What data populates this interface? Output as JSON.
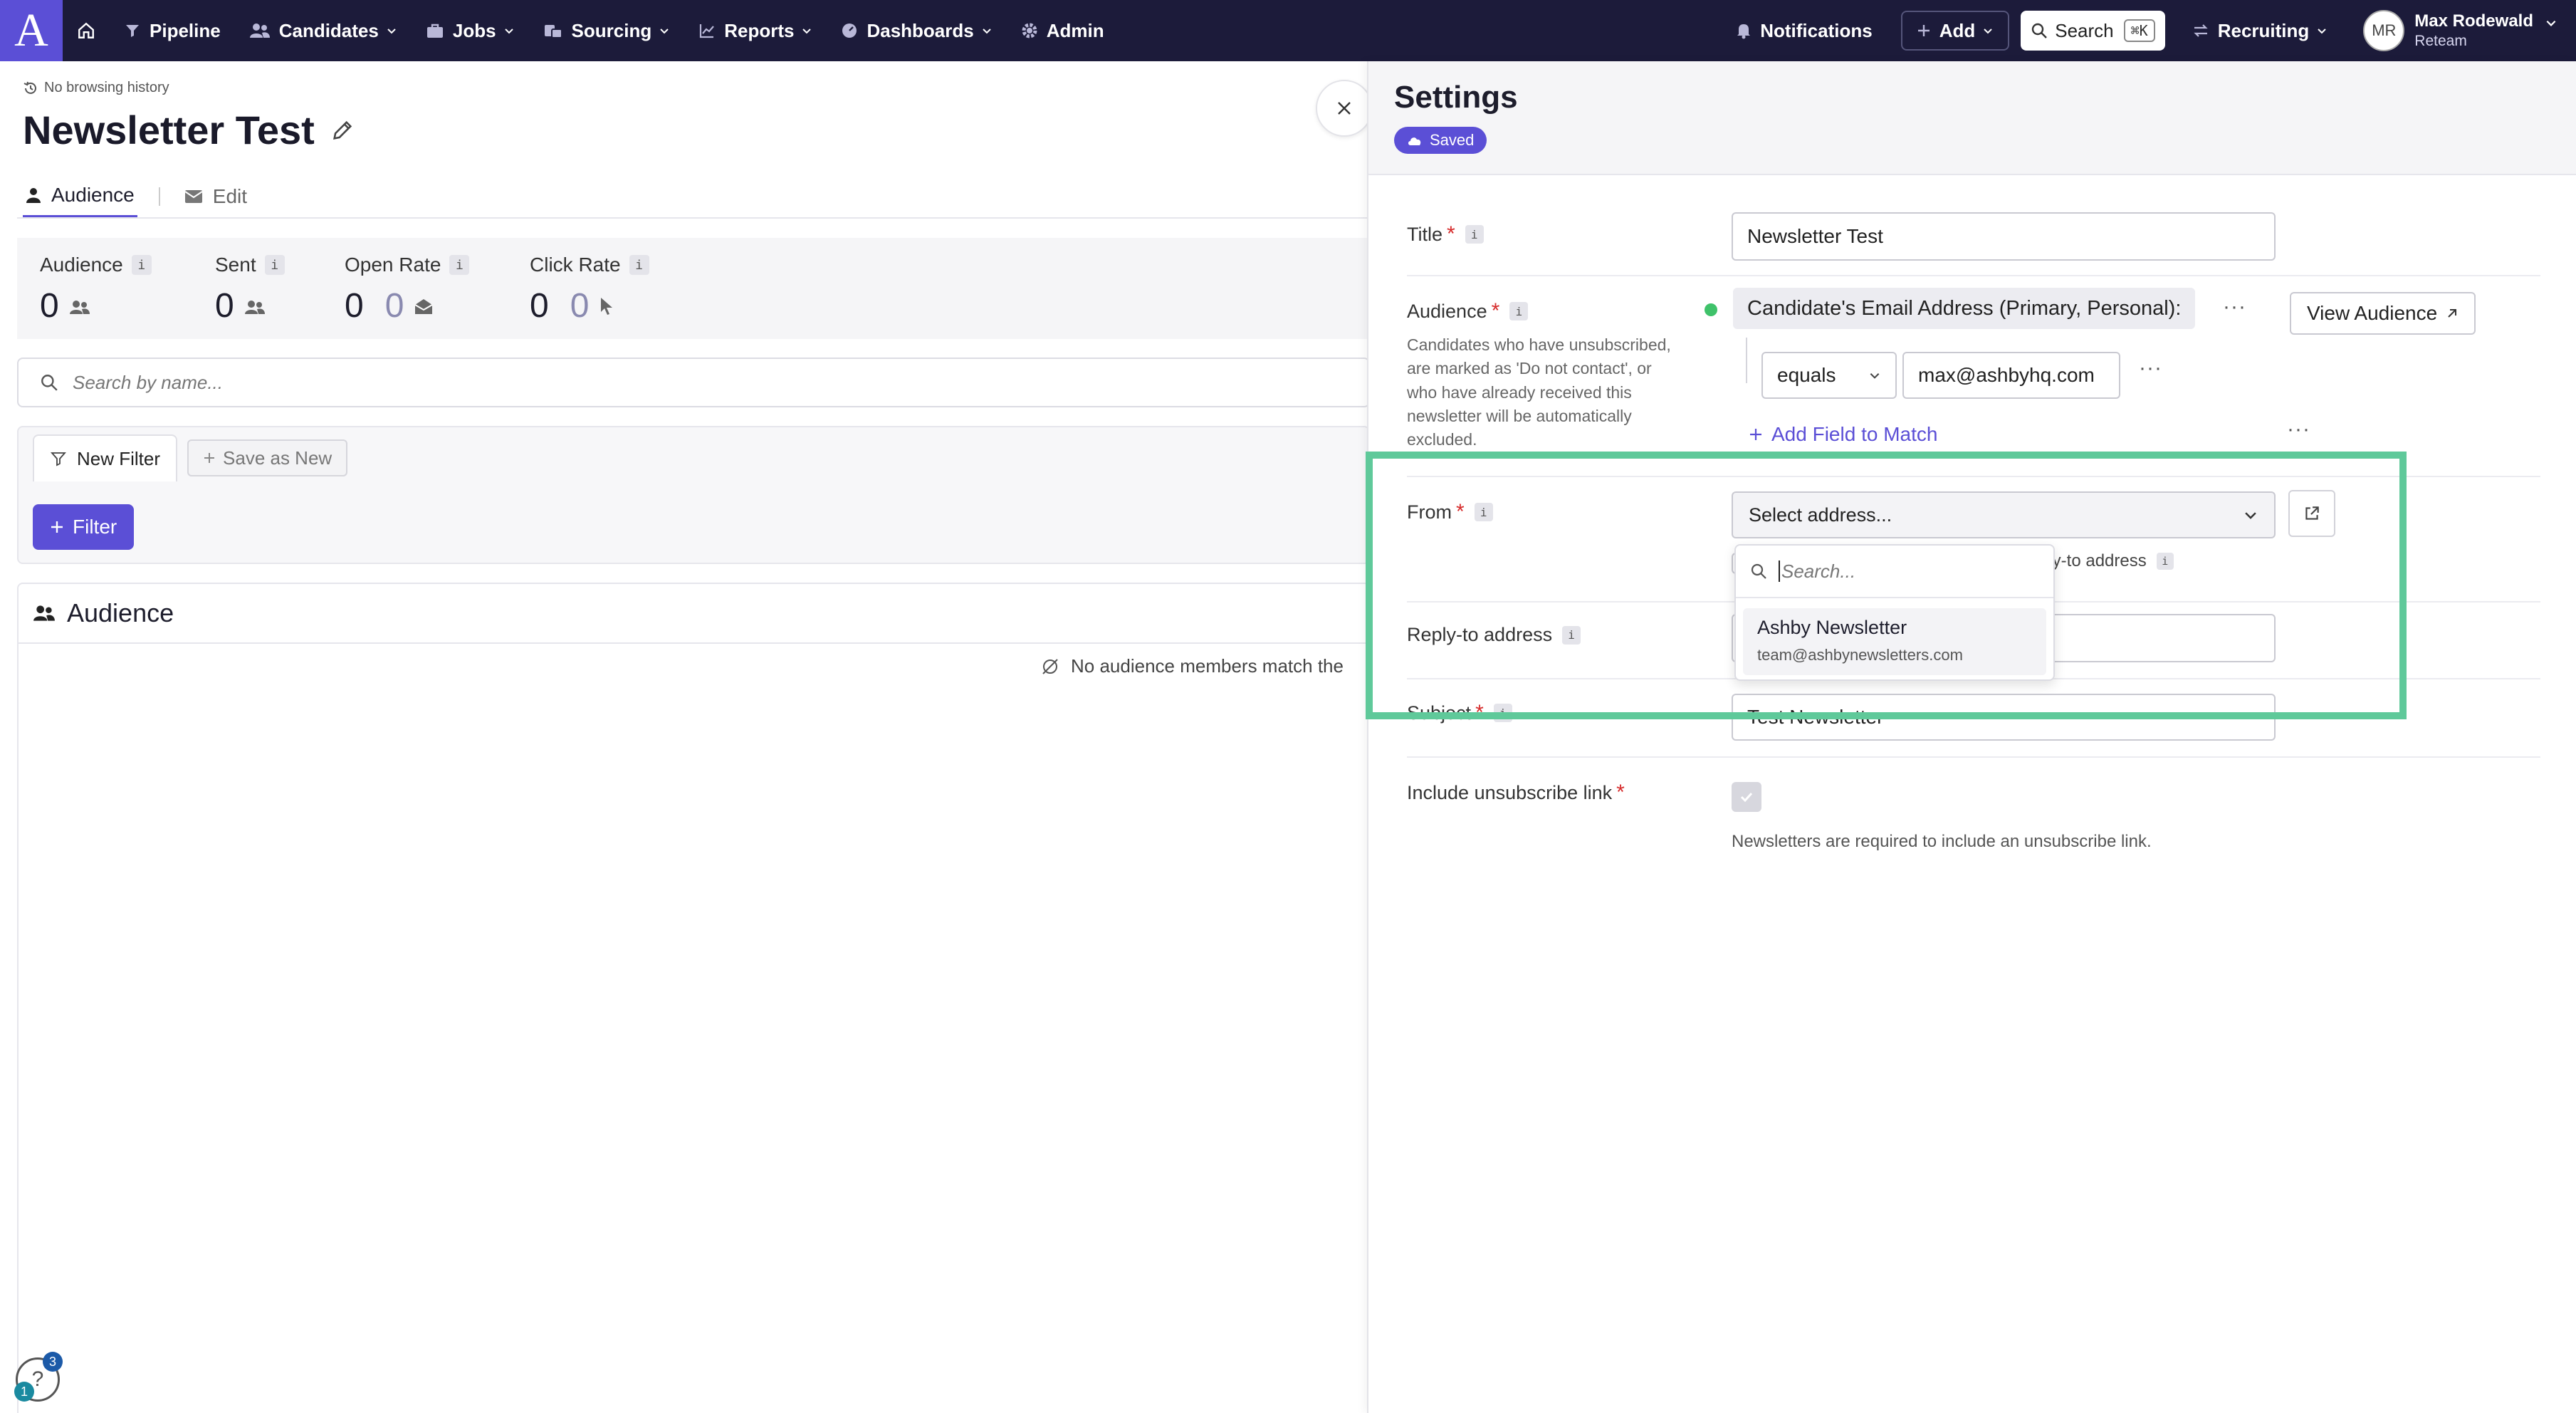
{
  "nav": {
    "logo": "A",
    "items": [
      {
        "label": "Pipeline",
        "icon": "filter-icon",
        "chevron": false
      },
      {
        "label": "Candidates",
        "icon": "people-icon",
        "chevron": true
      },
      {
        "label": "Jobs",
        "icon": "briefcase-icon",
        "chevron": true
      },
      {
        "label": "Sourcing",
        "icon": "sourcing-icon",
        "chevron": true
      },
      {
        "label": "Reports",
        "icon": "chart-icon",
        "chevron": true
      },
      {
        "label": "Dashboards",
        "icon": "gauge-icon",
        "chevron": true
      },
      {
        "label": "Admin",
        "icon": "gear-icon",
        "chevron": false
      }
    ],
    "notifications": "Notifications",
    "add": "Add",
    "search": "Search",
    "search_shortcut": "⌘K",
    "workspace": "Recruiting",
    "user_initials": "MR",
    "user_name": "Max Rodewald",
    "user_org": "Reteam"
  },
  "page": {
    "history": "No browsing history",
    "title": "Newsletter Test",
    "tabs": [
      {
        "label": "Audience"
      },
      {
        "label": "Edit"
      }
    ]
  },
  "stats": [
    {
      "label": "Audience",
      "value": "0",
      "value2": ""
    },
    {
      "label": "Sent",
      "value": "0",
      "value2": ""
    },
    {
      "label": "Open Rate",
      "value": "0",
      "value2": "0"
    },
    {
      "label": "Click Rate",
      "value": "0",
      "value2": "0"
    }
  ],
  "search": {
    "placeholder": "Search by name..."
  },
  "filters": {
    "new_filter": "New Filter",
    "save_as_new": "Save as New",
    "filter_button": "Filter"
  },
  "audience": {
    "heading": "Audience",
    "empty_text": "No audience members match the"
  },
  "help": {
    "badge_top": "3",
    "badge_bottom": "1"
  },
  "settings": {
    "title": "Settings",
    "status": "Saved",
    "fields": {
      "title_label": "Title",
      "title_value": "Newsletter Test",
      "audience_label": "Audience",
      "audience_help": "Candidates who have unsubscribed, are marked as 'Do not contact', or who have already received this newsletter will be automatically excluded.",
      "condition_field": "Candidate's Email Address (Primary, Personal):",
      "operator": "equals",
      "condition_value": "max@ashbyhq.com",
      "view_audience": "View Audience",
      "add_field": "Add Field to Match",
      "from_label": "From",
      "from_placeholder": "Select address...",
      "reply_hint": "ply-to address",
      "reply_label": "Reply-to address",
      "subject_label": "Subject",
      "subject_value": "Test Newsletter",
      "unsub_label": "Include unsubscribe link",
      "unsub_checked": true,
      "unsub_note": "Newsletters are required to include an unsubscribe link."
    },
    "dropdown": {
      "search_placeholder": "Search...",
      "options": [
        {
          "name": "Ashby Newsletter",
          "email": "team@ashbynewsletters.com"
        }
      ]
    }
  },
  "colors": {
    "nav_bg": "#1c1b3a",
    "accent": "#5b4fd6",
    "highlight": "#5fc99a",
    "required": "#d62b2b"
  }
}
